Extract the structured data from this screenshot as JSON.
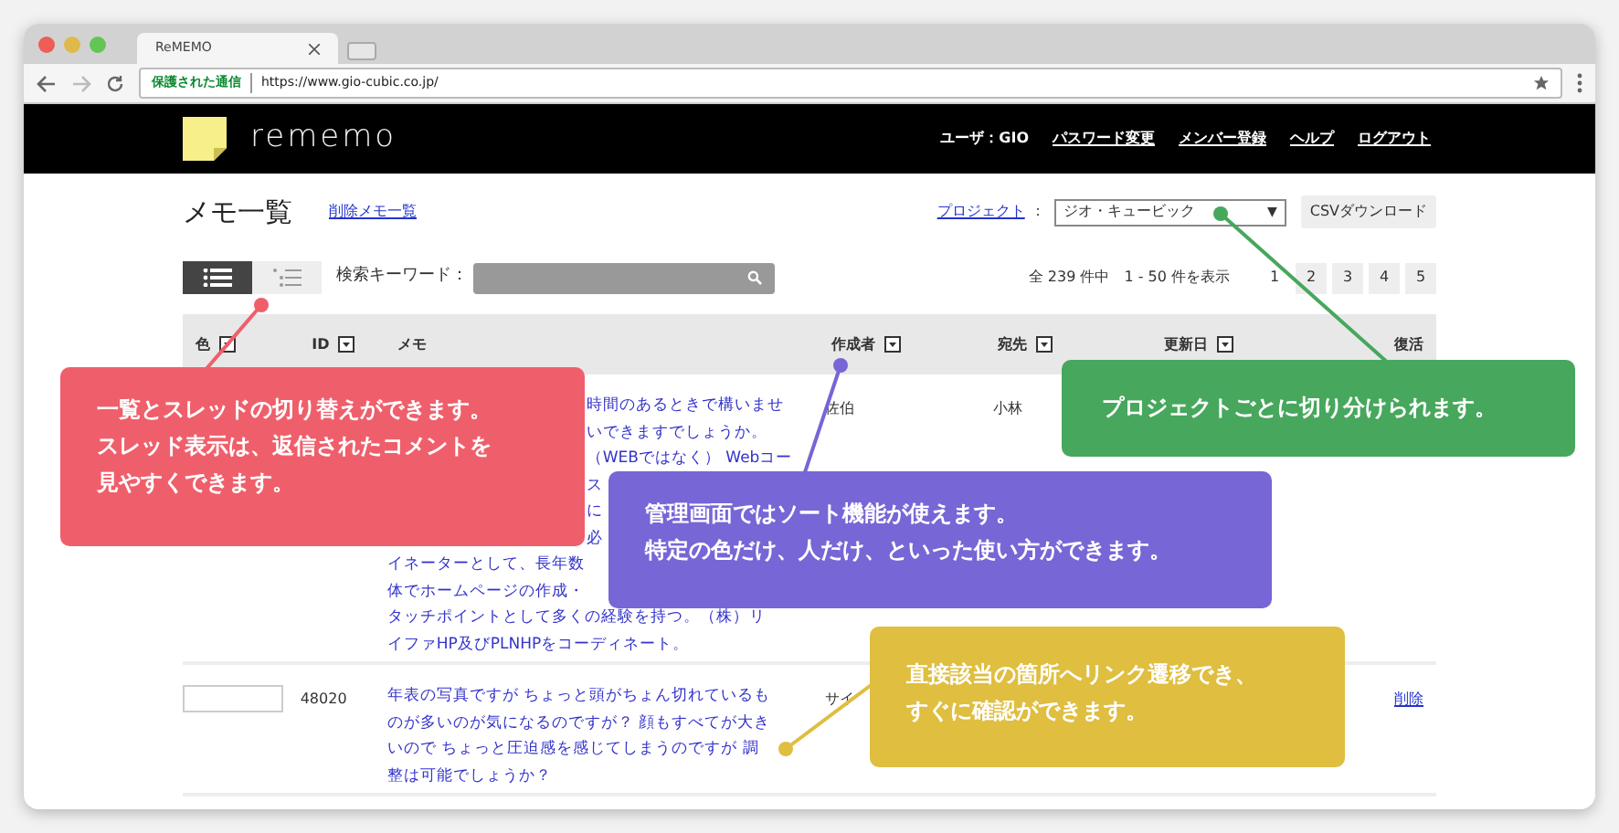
{
  "browser": {
    "tab_title": "ReMEMO",
    "secure_label": "保護された通信",
    "url": "https://www.gio-cubic.co.jp/"
  },
  "header": {
    "logo_text": "rememo",
    "user": "ユーザ：GIO",
    "links": [
      "パスワード変更",
      "メンバー登録",
      "ヘルプ",
      "ログアウト"
    ]
  },
  "page": {
    "title": "メモ一覧",
    "deleted_link": "削除メモ一覧",
    "project_label": "プロジェクト",
    "project_colon": "：",
    "project_value": "ジオ・キュービック",
    "project_caret": "▼",
    "csv_button": "CSVダウンロード"
  },
  "views": [
    {
      "kind": "list",
      "selected": true
    },
    {
      "kind": "thread",
      "selected": false
    }
  ],
  "search": {
    "label": "検索キーワード："
  },
  "summary": "全 239 件中　1 - 50 件を表示",
  "pages": [
    {
      "label": "1",
      "selected": true
    },
    {
      "label": "2",
      "selected": false
    },
    {
      "label": "3",
      "selected": false
    },
    {
      "label": "4",
      "selected": false
    },
    {
      "label": "5",
      "selected": false
    }
  ],
  "table": {
    "columns": [
      {
        "label": "色",
        "sortable": true
      },
      {
        "label": "ID",
        "sortable": true
      },
      {
        "label": "メモ",
        "sortable": false
      },
      {
        "label": "作成者",
        "sortable": true
      },
      {
        "label": "宛先",
        "sortable": true
      },
      {
        "label": "更新日",
        "sortable": true
      },
      {
        "label": "復活",
        "sortable": false
      }
    ],
    "rows": [
      {
        "memo_lines": [
          {
            "text": "時間のあるときで構いませ",
            "kind": "clipped"
          },
          {
            "text": "いできますでしょうか。",
            "kind": "clipped"
          },
          {
            "text": "（WEBではなく） Webコー",
            "kind": "clipped"
          },
          {
            "text": "ス",
            "kind": "clipped"
          },
          {
            "text": "に",
            "kind": "clipped"
          },
          {
            "text": "必",
            "kind": "clipped"
          },
          {
            "text": "イネーターとして、長年数",
            "kind": "full"
          },
          {
            "text": "体でホームページの作成・",
            "kind": "full"
          },
          {
            "text": "タッチポイントとして多くの経験を持つ。（株）リ",
            "kind": "full"
          },
          {
            "text": "イファHP及びPLNHPをコーディネート。",
            "kind": "full"
          }
        ],
        "author": "佐伯",
        "recipient": "小林"
      },
      {
        "has_color_box": true,
        "id": "48020",
        "memo_lines": [
          {
            "text": "年表の写真ですが ちょっと頭がちょん切れているも",
            "kind": "full"
          },
          {
            "text": "のが多いのが気になるのですが？ 顔もすべてが大き",
            "kind": "full"
          },
          {
            "text": "いので ちょっと圧迫感を感じてしまうのですが 調",
            "kind": "full"
          },
          {
            "text": "整は可能でしょうか？",
            "kind": "full"
          }
        ],
        "author": "サイ",
        "action": "削除"
      }
    ]
  },
  "callouts": [
    {
      "lines": [
        "一覧とスレッドの切り替えができます。",
        "スレッド表示は、返信されたコメントを",
        "見やすくできます。"
      ],
      "color": "#ef5f6b"
    },
    {
      "lines": [
        "管理画面ではソート機能が使えます。",
        "特定の色だけ、人だけ、といった使い方ができます。"
      ],
      "color": "#7766d6"
    },
    {
      "lines": [
        "プロジェクトごとに切り分けられます。"
      ],
      "color": "#47a75d"
    },
    {
      "lines": [
        "直接該当の箇所へリンク遷移でき、",
        "すぐに確認ができます。"
      ],
      "color": "#dfbe40"
    }
  ]
}
